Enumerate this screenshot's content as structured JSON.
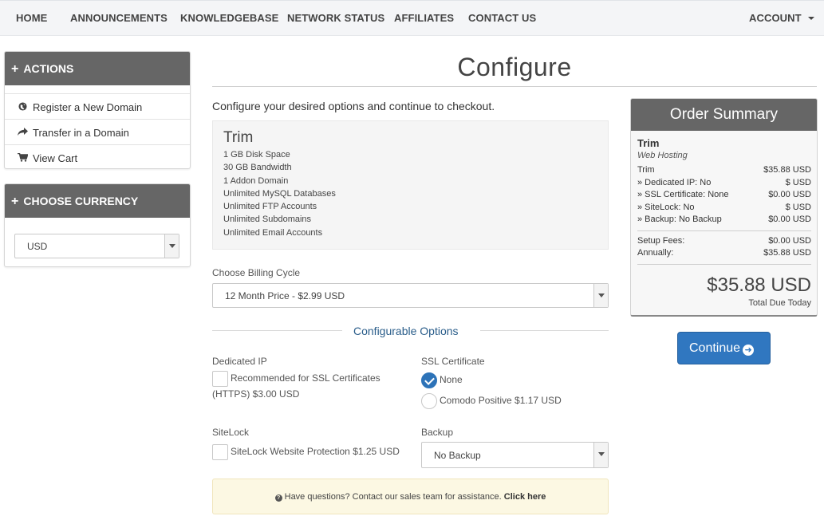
{
  "nav": {
    "items": [
      "HOME",
      "ANNOUNCEMENTS",
      "KNOWLEDGEBASE",
      "NETWORK STATUS",
      "AFFILIATES",
      "CONTACT US"
    ],
    "account": "ACCOUNT"
  },
  "sidebar": {
    "actions": {
      "title": "ACTIONS",
      "links": [
        {
          "label": "Register a New Domain",
          "icon": "globe-icon"
        },
        {
          "label": "Transfer in a Domain",
          "icon": "share-arrow-icon"
        },
        {
          "label": "View Cart",
          "icon": "cart-icon"
        }
      ]
    },
    "currency": {
      "title": "CHOOSE CURRENCY",
      "selected": "USD"
    }
  },
  "main": {
    "title": "Configure",
    "intro": "Configure your desired options and continue to checkout.",
    "product": {
      "name": "Trim",
      "features": [
        "1 GB Disk Space",
        "30 GB Bandwidth",
        "1 Addon Domain",
        "Unlimited MySQL Databases",
        "Unlimited FTP Accounts",
        "Unlimited Subdomains",
        "Unlimited Email Accounts"
      ]
    },
    "billing": {
      "label": "Choose Billing Cycle",
      "selected": "12 Month Price - $2.99 USD"
    },
    "configurable": {
      "title": "Configurable Options",
      "dedicated_ip": {
        "label": "Dedicated IP",
        "option_line1": "Recommended for SSL Certificates",
        "option_line2": "(HTTPS) $3.00 USD",
        "checked": false
      },
      "ssl": {
        "label": "SSL Certificate",
        "options": [
          {
            "label": "None",
            "checked": true
          },
          {
            "label": "Comodo Positive $1.17 USD",
            "checked": false
          }
        ]
      },
      "sitelock": {
        "label": "SiteLock",
        "option": "SiteLock Website Protection $1.25 USD",
        "checked": false
      },
      "backup": {
        "label": "Backup",
        "selected": "No Backup"
      }
    },
    "help": {
      "text": "Have questions? Contact our sales team for assistance.",
      "link": "Click here"
    }
  },
  "summary": {
    "title": "Order Summary",
    "product": "Trim",
    "group": "Web Hosting",
    "lines": [
      {
        "label": "Trim",
        "value": "$35.88 USD"
      },
      {
        "label": "» Dedicated IP: No",
        "value": "$ USD"
      },
      {
        "label": "» SSL Certificate: None",
        "value": "$0.00 USD"
      },
      {
        "label": "» SiteLock: No",
        "value": "$ USD"
      },
      {
        "label": "» Backup: No Backup",
        "value": "$0.00 USD"
      }
    ],
    "fees": [
      {
        "label": "Setup Fees:",
        "value": "$0.00 USD"
      },
      {
        "label": "Annually:",
        "value": "$35.88 USD"
      }
    ],
    "total": "$35.88 USD",
    "total_label": "Total Due Today"
  },
  "continue_label": "Continue",
  "colors": {
    "panel_header": "#666666",
    "primary_button": "#3077c0",
    "link_blue": "#2a5d8a",
    "help_bg": "#fcf8e3"
  }
}
